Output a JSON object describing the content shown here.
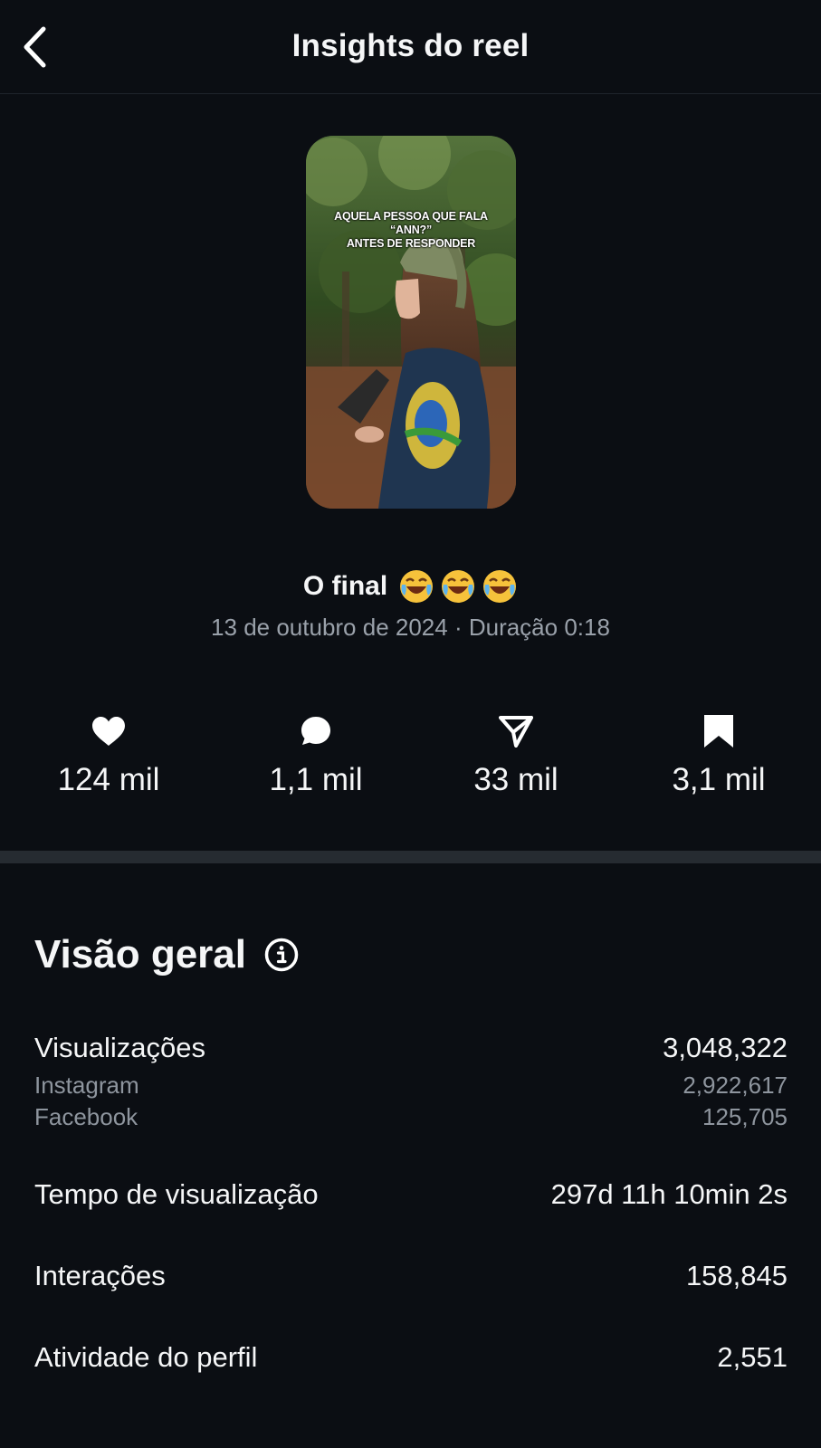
{
  "header": {
    "title": "Insights do reel",
    "back_icon": "chevron-left-icon"
  },
  "reel": {
    "thumbnail_caption_line1": "AQUELA PESSOA QUE FALA “ANN?”",
    "thumbnail_caption_line2": "ANTES DE RESPONDER",
    "title": "O final",
    "title_emoji": "face-with-tears-of-joy x3",
    "meta": "13 de outubro de 2024 · Duração 0:18"
  },
  "stats": {
    "likes": {
      "icon": "heart-icon",
      "value": "124 mil"
    },
    "comments": {
      "icon": "comment-icon",
      "value": "1,1 mil"
    },
    "shares": {
      "icon": "send-icon",
      "value": "33 mil"
    },
    "saves": {
      "icon": "bookmark-icon",
      "value": "3,1 mil"
    }
  },
  "overview": {
    "title": "Visão geral",
    "info_icon": "info-icon",
    "views": {
      "label": "Visualizações",
      "value": "3,048,322"
    },
    "instagram": {
      "label": "Instagram",
      "value": "2,922,617"
    },
    "facebook": {
      "label": "Facebook",
      "value": "125,705"
    },
    "watch_time": {
      "label": "Tempo de visualização",
      "value": "297d 11h 10min 2s"
    },
    "interactions": {
      "label": "Interações",
      "value": "158,845"
    },
    "profile_activity": {
      "label": "Atividade do perfil",
      "value": "2,551"
    }
  },
  "colors": {
    "background": "#0b0e13",
    "divider": "#262b31",
    "muted_text": "#9aa1aa"
  }
}
